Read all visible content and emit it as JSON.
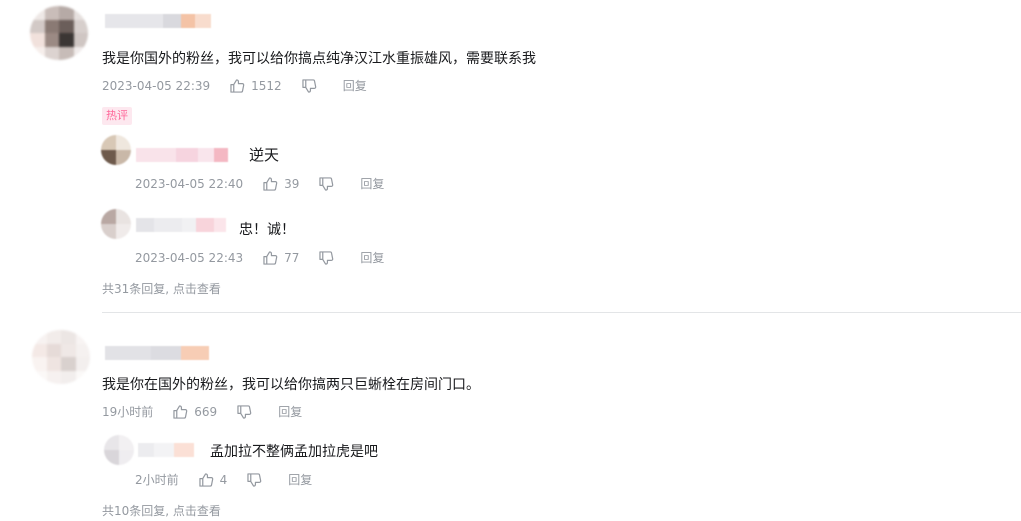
{
  "comments": [
    {
      "text": "我是你国外的粉丝，我可以给你搞点纯净汉江水重振雄风，需要联系我",
      "time": "2023-04-05 22:39",
      "likes": "1512",
      "reply_label": "回复",
      "hot_tag": "热评",
      "replies": [
        {
          "text": "逆天",
          "time": "2023-04-05 22:40",
          "likes": "39",
          "reply_label": "回复"
        },
        {
          "text": "忠！诚！",
          "time": "2023-04-05 22:43",
          "likes": "77",
          "reply_label": "回复"
        }
      ],
      "more_replies": "共31条回复, 点击查看"
    },
    {
      "text": "我是你在国外的粉丝，我可以给你搞两只巨蜥栓在房间门口。",
      "time": "19小时前",
      "likes": "669",
      "reply_label": "回复",
      "replies": [
        {
          "text": "孟加拉不整俩孟加拉虎是吧",
          "time": "2小时前",
          "likes": "4",
          "reply_label": "回复"
        }
      ],
      "more_replies": "共10条回复, 点击查看"
    }
  ],
  "colors": {
    "hot_tag_text": "#ff6699",
    "hot_tag_bg": "#fde8ef",
    "meta_text": "#9499a0",
    "divider": "#e3e5e7"
  },
  "icons": {
    "like": "thumb-up-icon",
    "dislike": "thumb-down-icon"
  }
}
